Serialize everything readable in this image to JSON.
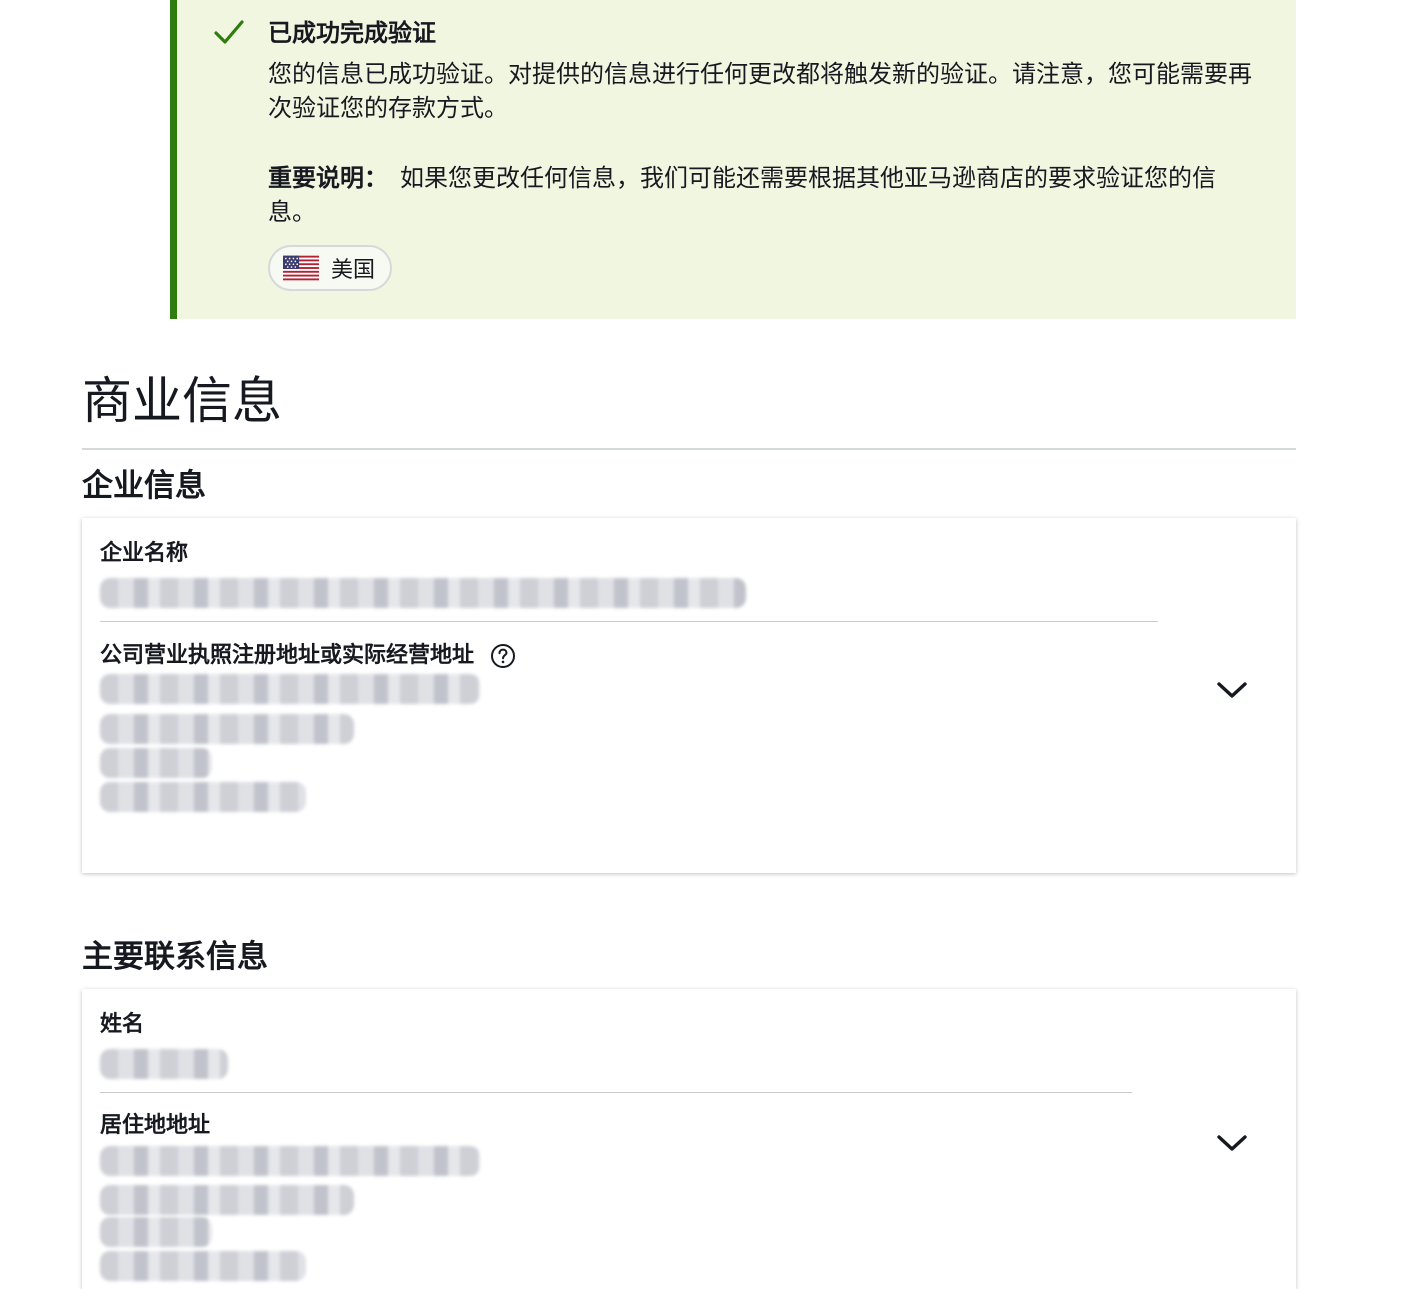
{
  "alert": {
    "title": "已成功完成验证",
    "body": "您的信息已成功验证。对提供的信息进行任何更改都将触发新的验证。请注意，您可能需要再次验证您的存款方式。",
    "note_label": "重要说明：",
    "note_text": "如果您更改任何信息，我们可能还需要根据其他亚马逊商店的要求验证您的信息。",
    "country": "美国",
    "icon": "check-icon",
    "accent_color": "#2e7d0e",
    "background_color": "#f1f6e1"
  },
  "page": {
    "title": "商业信息"
  },
  "business": {
    "section_title": "企业信息",
    "name_label": "企业名称",
    "address_label": "公司营业执照注册地址或实际经营地址"
  },
  "contact": {
    "section_title": "主要联系信息",
    "name_label": "姓名",
    "address_label": "居住地地址"
  }
}
